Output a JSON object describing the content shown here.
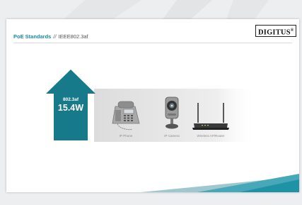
{
  "brand": {
    "logo_text": "DIGITUS",
    "logo_mark": "®"
  },
  "header": {
    "title": "PoE Standards",
    "separator": "//",
    "subtitle": "IEEE802.3af"
  },
  "arrow": {
    "standard": "802.3af",
    "power": "15.4W",
    "color": "#177a8a"
  },
  "devices": [
    {
      "label": "IP Phone",
      "icon": "ip-phone-icon"
    },
    {
      "label": "IP Camera",
      "icon": "ip-camera-icon"
    },
    {
      "label": "Wireless AP/Router",
      "icon": "wireless-router-icon"
    }
  ],
  "colors": {
    "accent": "#1a8aa3",
    "arrow": "#177a8a",
    "footer": "#1e93a6"
  }
}
